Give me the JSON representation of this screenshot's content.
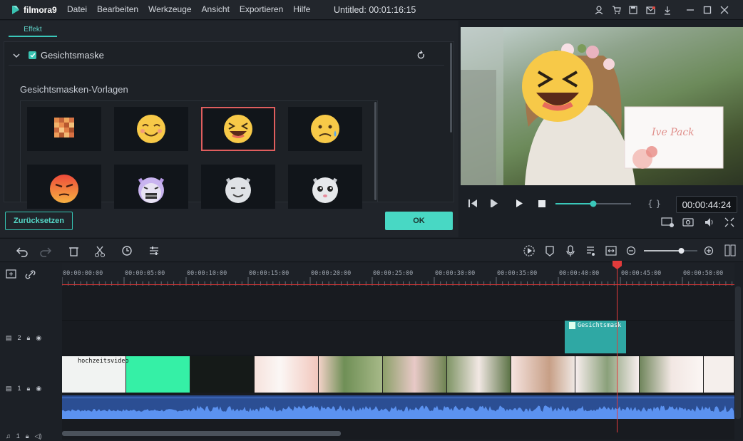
{
  "app": {
    "brand": "filmora9",
    "title": "Untitled:",
    "duration": "00:01:16:15"
  },
  "menu": [
    "Datei",
    "Bearbeiten",
    "Werkzeuge",
    "Ansicht",
    "Exportieren",
    "Hilfe"
  ],
  "effect_panel": {
    "tab": "Effekt",
    "section_title": "Gesichtsmaske",
    "templates_label": "Gesichtsmasken-Vorlagen",
    "reset_label": "Zurücksetzen",
    "ok_label": "OK"
  },
  "preview": {
    "overlay_text": "Ive Pack",
    "timecode": "00:00:44:24",
    "progress": 0.5
  },
  "zoom": {
    "level": 0.7
  },
  "timeline": {
    "ruler": [
      "00:00:00:00",
      "00:00:05:00",
      "00:00:10:00",
      "00:00:15:00",
      "00:00:20:00",
      "00:00:25:00",
      "00:00:30:00",
      "00:00:35:00",
      "00:00:40:00",
      "00:00:45:00",
      "00:00:50:00"
    ],
    "track2_label": "2",
    "track1_label": "1",
    "track_audio_label": "1",
    "fx_clip_label": "Gesichtsmask",
    "video_clip_label": "hochzeitsvideo"
  },
  "colors": {
    "accent": "#3ac7ba",
    "playhead": "#e23b3b",
    "fx_clip": "#2fa8a4",
    "audio": "#2b4e93"
  }
}
